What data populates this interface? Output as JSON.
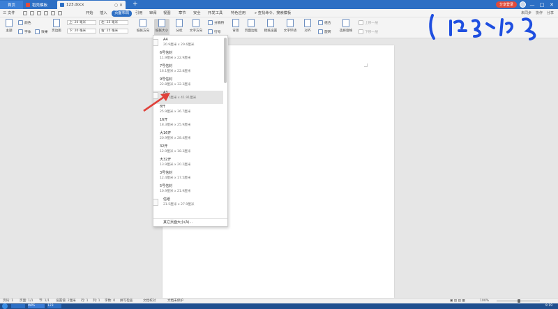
{
  "titlebar": {
    "tabs": [
      {
        "label": "首页",
        "color": "#2d6fc4"
      },
      {
        "label": "稻壳模板",
        "color": "#e24b3b"
      },
      {
        "label": "123.docx",
        "color": "#2d6fc4"
      }
    ],
    "login_label": "分享登录",
    "window_controls": [
      "—",
      "□",
      "✕"
    ]
  },
  "menu": {
    "file_label": "三 文件",
    "items": [
      "开始",
      "插入",
      "页面布局",
      "引用",
      "审阅",
      "视图",
      "章节",
      "安全",
      "开发工具",
      "特色应用"
    ],
    "active_index": 2,
    "search_label": "查找命令、搜索模板",
    "right_items": [
      "未同步",
      "协作",
      "分享"
    ]
  },
  "ribbon": {
    "theme": "主题",
    "colors": "颜色",
    "font": "字体",
    "effects": "效果",
    "page_margin": "页边距",
    "margin_top": "上: 20 毫米",
    "margin_bottom": "下: 20 毫米",
    "margin_left": "左: 25 毫米",
    "margin_right": "右: 25 毫米",
    "orientation": "纸张方向",
    "size": "纸张大小",
    "columns": "分栏",
    "text_direction": "文字方向",
    "line_numbers": "行号",
    "separators": "分隔符",
    "background": "背景",
    "page_border": "页面边框",
    "manuscript": "稿纸设置",
    "text_wrap": "文字环绕",
    "align": "对齐",
    "rotate": "旋转",
    "group": "组合",
    "select_pane": "选择窗格",
    "bring_forward": "上移一层",
    "send_backward": "下移一层"
  },
  "paper_sizes": [
    {
      "name": "A4",
      "dims": "20.9厘米 x 29.6厘米"
    },
    {
      "name": "6号信封",
      "dims": "11.9厘米 x 22.9厘米"
    },
    {
      "name": "7号信封",
      "dims": "16.1厘米 x 22.8厘米"
    },
    {
      "name": "9号信封",
      "dims": "22.8厘米 x 32.3厘米"
    },
    {
      "name": "A3",
      "dims": "29.7厘米 x 41.91厘米"
    },
    {
      "name": "8开",
      "dims": "25.9厘米 x 36.7厘米"
    },
    {
      "name": "16开",
      "dims": "18.3厘米 x 25.9厘米"
    },
    {
      "name": "大16开",
      "dims": "20.9厘米 x 28.4厘米"
    },
    {
      "name": "32开",
      "dims": "12.9厘米 x 18.3厘米"
    },
    {
      "name": "大32开",
      "dims": "13.9厘米 x 20.2厘米"
    },
    {
      "name": "3号信封",
      "dims": "12.4厘米 x 17.5厘米"
    },
    {
      "name": "5号信封",
      "dims": "10.9厘米 x 21.9厘米"
    },
    {
      "name": "信纸",
      "dims": "21.5厘米 x 27.9厘米"
    }
  ],
  "paper_selected_index": 4,
  "dropdown_footer": "其它页面大小(A)...",
  "statusbar": {
    "page": "页码: 1",
    "pages": "页面: 1/1",
    "section": "节: 1/1",
    "position": "设置值: 2厘米",
    "line": "行: 1",
    "column": "列: 1",
    "words": "字数: 0",
    "spell": "拼写检查",
    "proof": "文档校对",
    "protect": "文档未保护",
    "zoom": "100%"
  },
  "taskbar": {
    "items": [
      "",
      "WPS",
      "123",
      ""
    ],
    "clock": "9:19"
  },
  "colors": {
    "accent": "#2d6fc4",
    "login": "#e24b3b",
    "arrow": "#e0413a",
    "scribble": "#1f4fe0"
  }
}
